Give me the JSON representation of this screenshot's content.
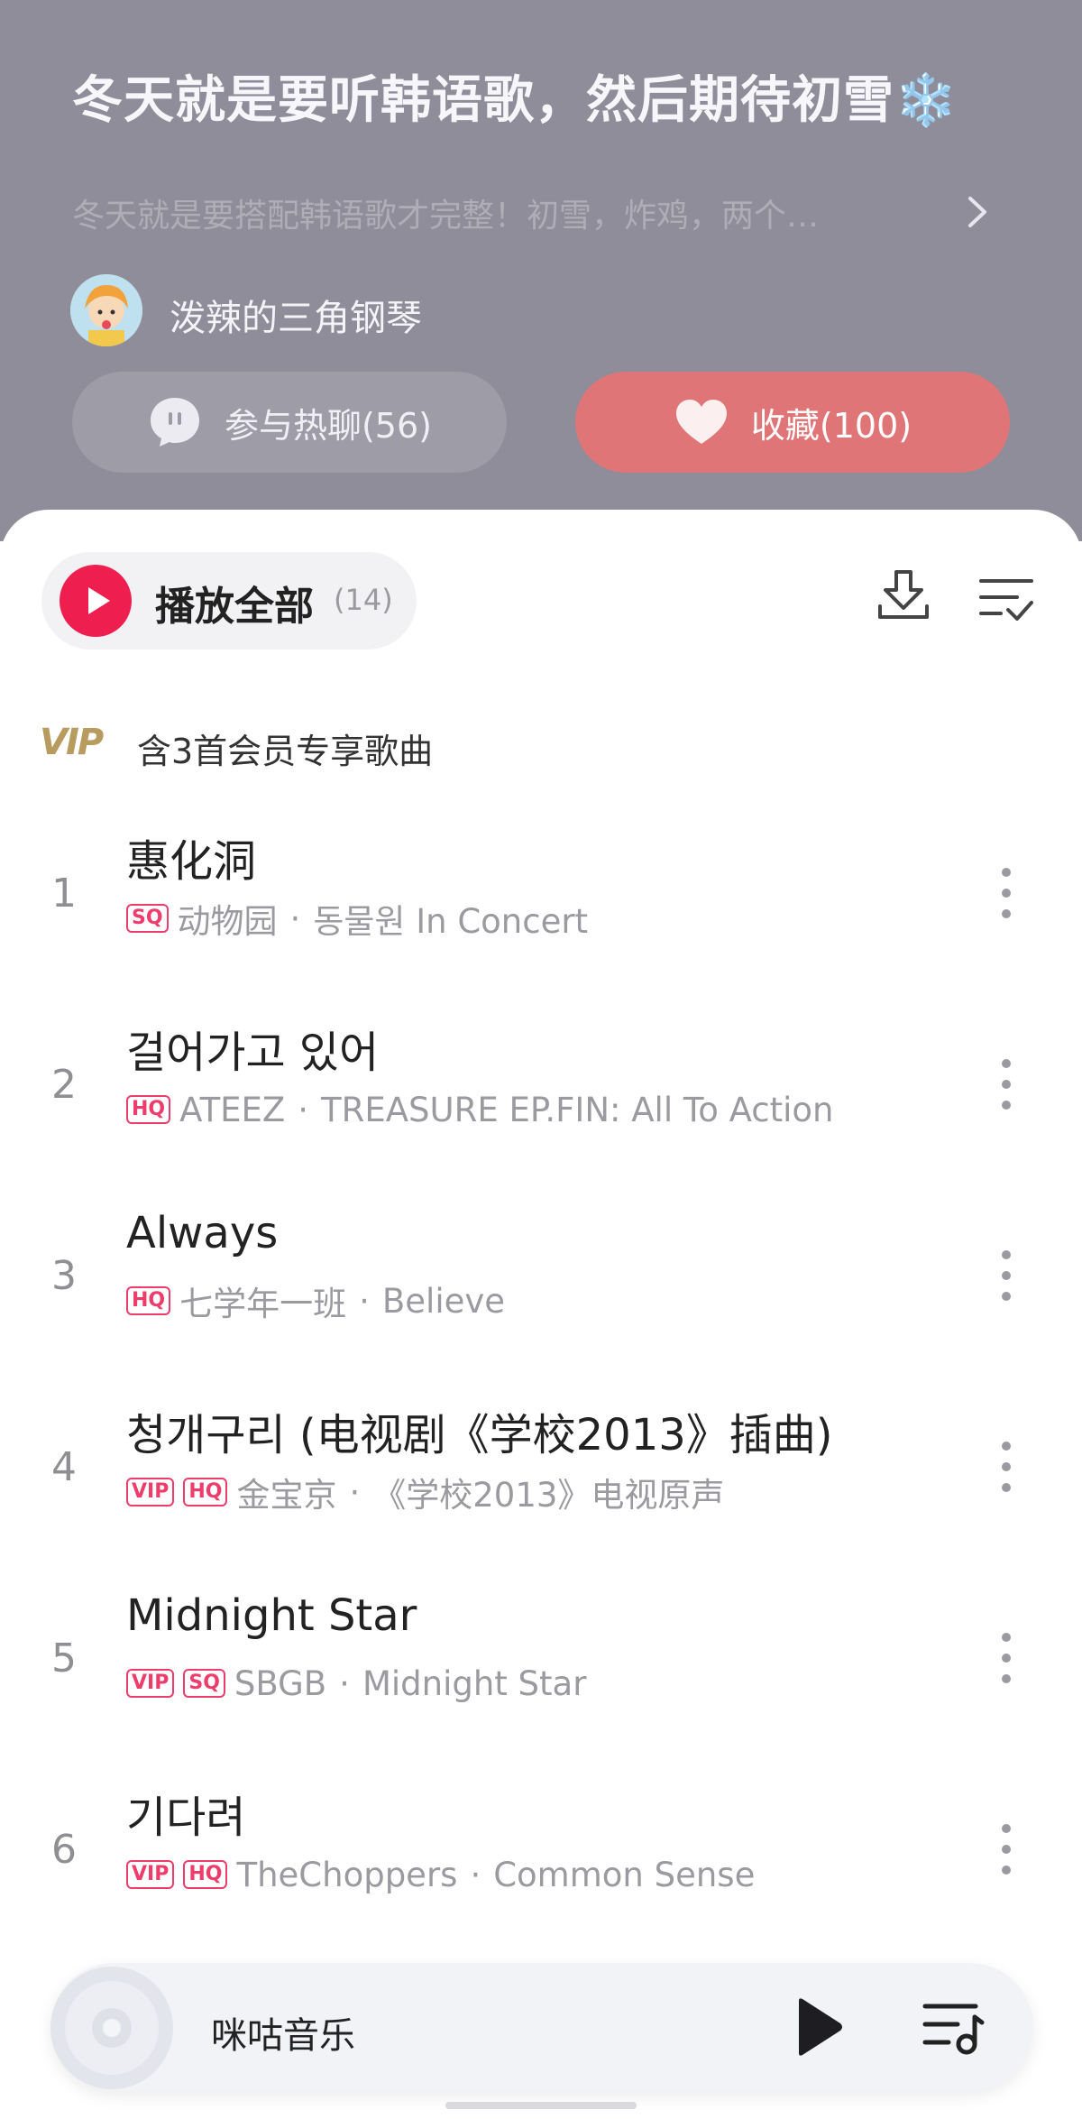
{
  "header": {
    "title": "冬天就是要听韩语歌，然后期待初雪",
    "title_emoji": "❄️",
    "description": "冬天就是要搭配韩语歌才完整！初雪，炸鸡，两个…",
    "creator_name": "泼辣的三角钢琴",
    "chat_button": "参与热聊(56)",
    "favorite_button": "收藏(100)"
  },
  "toolbar": {
    "play_all_label": "播放全部",
    "play_all_count": "(14)"
  },
  "vip_notice": {
    "logo": "VIP",
    "text": "含3首会员专享歌曲"
  },
  "songs": [
    {
      "index": "1",
      "title": "惠化洞",
      "badges": [
        "SQ"
      ],
      "artist": "动物园",
      "album": "동물원 In Concert"
    },
    {
      "index": "2",
      "title": "걸어가고 있어",
      "badges": [
        "HQ"
      ],
      "artist": "ATEEZ",
      "album": "TREASURE EP.FIN: All To Action"
    },
    {
      "index": "3",
      "title": "Always",
      "badges": [
        "HQ"
      ],
      "artist": "七学年一班",
      "album": "Believe"
    },
    {
      "index": "4",
      "title": "청개구리 (电视剧《学校2013》插曲)",
      "badges": [
        "VIP",
        "HQ"
      ],
      "artist": "金宝京",
      "album": "《学校2013》电视原声"
    },
    {
      "index": "5",
      "title": "Midnight Star",
      "badges": [
        "VIP",
        "SQ"
      ],
      "artist": "SBGB",
      "album": "Midnight Star"
    },
    {
      "index": "6",
      "title": "기다려",
      "badges": [
        "VIP",
        "HQ"
      ],
      "artist": "TheChoppers",
      "album": "Common Sense"
    }
  ],
  "player": {
    "name": "咪咕音乐"
  },
  "colors": {
    "header_bg": "#8e8d99",
    "accent_red": "#ee1f4f",
    "favorite_bg": "#e07577",
    "badge_pink": "#ee3d6a",
    "vip_gold": "#b89b5e"
  },
  "icons": [
    "chevron-right-icon",
    "chat-bubble-icon",
    "heart-icon",
    "play-circle-icon",
    "download-icon",
    "multi-select-icon",
    "more-vertical-icon",
    "disc-icon",
    "play-icon",
    "playlist-icon"
  ]
}
